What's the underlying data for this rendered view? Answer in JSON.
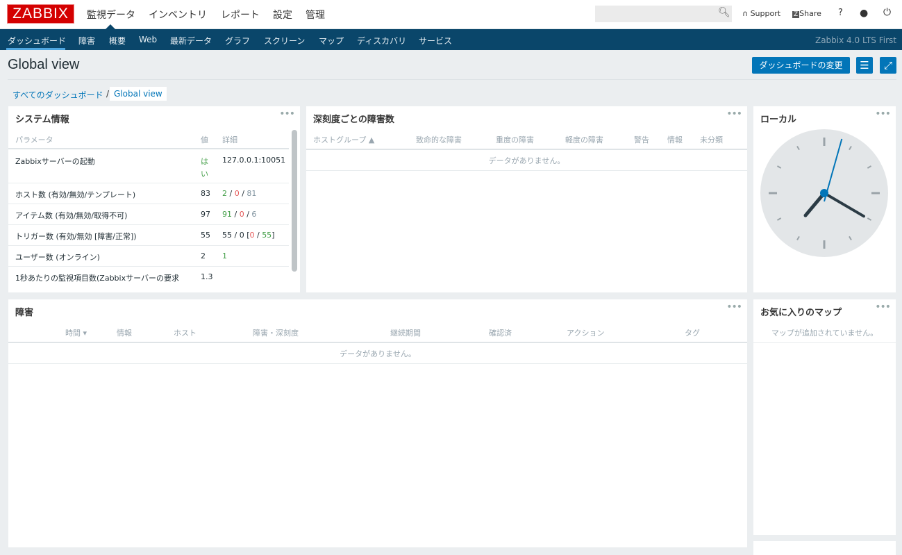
{
  "header": {
    "logo": "ZABBIX",
    "main_menu": [
      "監視データ",
      "インベントリ",
      "レポート",
      "設定",
      "管理"
    ],
    "search": {
      "value": "",
      "placeholder": ""
    },
    "support": "Support",
    "share": "Share",
    "help": "?"
  },
  "nav": {
    "items": [
      "ダッシュボード",
      "障害",
      "概要",
      "Web",
      "最新データ",
      "グラフ",
      "スクリーン",
      "マップ",
      "ディスカバリ",
      "サービス"
    ],
    "active": "ダッシュボード",
    "version": "Zabbix 4.0 LTS First"
  },
  "page": {
    "title": "Global view",
    "edit_button": "ダッシュボードの変更",
    "breadcrumb": {
      "root": "すべてのダッシュボード",
      "sep": "/",
      "current": "Global view"
    }
  },
  "sysinfo": {
    "title": "システム情報",
    "headers": [
      "パラメータ",
      "値",
      "詳細"
    ],
    "rows": [
      {
        "param": "Zabbixサーバーの起動",
        "value": "はい",
        "details": "127.0.0.1:10051"
      },
      {
        "param": "ホスト数 (有効/無効/テンプレート)",
        "value": "83",
        "d1": "2",
        "d2": "0",
        "d3": "81"
      },
      {
        "param": "アイテム数 (有効/無効/取得不可)",
        "value": "97",
        "d1": "91",
        "d2": "0",
        "d3": "6"
      },
      {
        "param": "トリガー数 (有効/無効 [障害/正常])",
        "value": "55",
        "pre": "55 / 0 [",
        "d2": "0",
        "d1": "55",
        "post": "]"
      },
      {
        "param": "ユーザー数 (オンライン)",
        "value": "2",
        "d1": "1"
      },
      {
        "param": "1秒あたりの監視項目数(Zabbixサーバーの要求",
        "value": "1.3"
      }
    ]
  },
  "severity": {
    "title": "深刻度ごとの障害数",
    "headers": [
      "ホストグループ ▲",
      "致命的な障害",
      "重度の障害",
      "軽度の障害",
      "警告",
      "情報",
      "未分類"
    ],
    "empty": "データがありません。"
  },
  "clock": {
    "title": "ローカル",
    "time": "07:20:03"
  },
  "problems": {
    "title": "障害",
    "headers": [
      "時間 ▾",
      "情報",
      "ホスト",
      "障害・深刻度",
      "継続期間",
      "確認済",
      "アクション",
      "タグ"
    ],
    "empty": "データがありません。"
  },
  "favmaps": {
    "title": "お気に入りのマップ",
    "empty": "マップが追加されていません。"
  },
  "colors": {
    "nav": "#0a466a",
    "accent": "#0275b8",
    "ok": "#429e47",
    "problem": "#e45959",
    "logo": "#d40000"
  }
}
